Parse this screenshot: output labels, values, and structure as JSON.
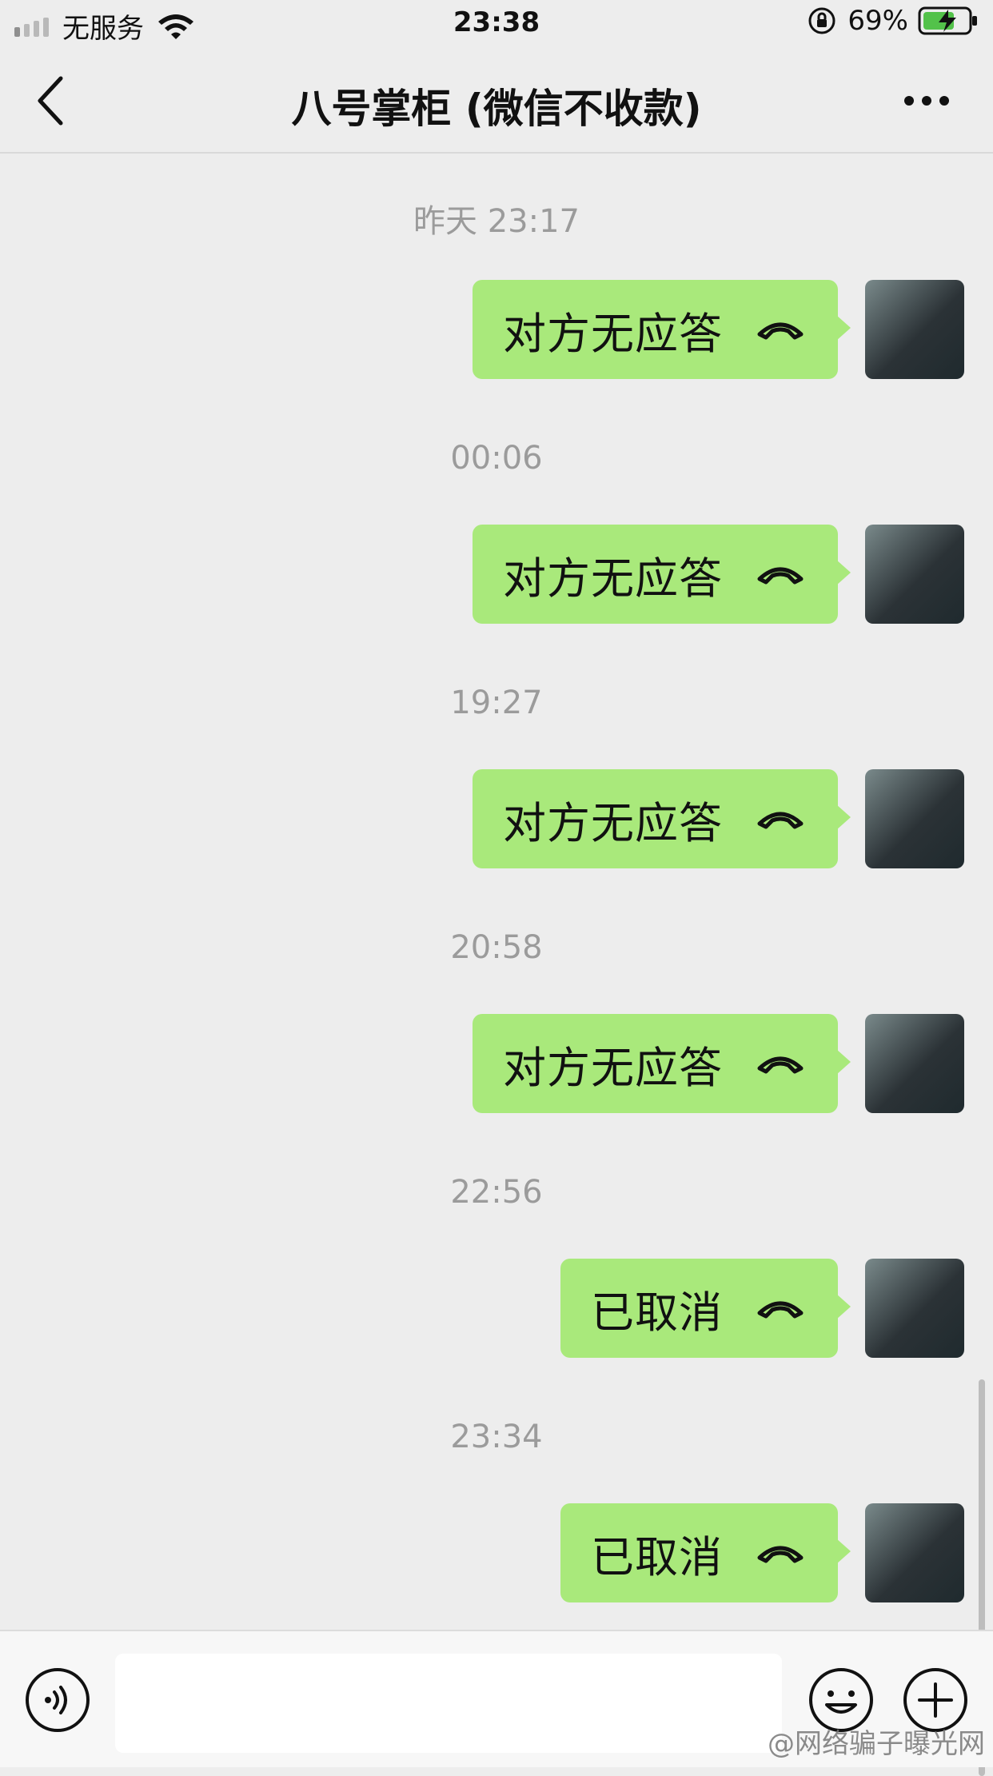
{
  "status_bar": {
    "carrier": "无服务",
    "time": "23:38",
    "battery_percent": "69%",
    "icons": [
      "signal-icon",
      "wifi-icon",
      "rotation-lock-icon",
      "battery-charging-icon"
    ]
  },
  "nav": {
    "title": "八号掌柜 (微信不收款)",
    "icons": [
      "back-chevron-icon",
      "more-icon"
    ]
  },
  "chat": {
    "timestamps": [
      "昨天 23:17",
      "00:06",
      "19:27",
      "20:58",
      "22:56",
      "23:34"
    ],
    "messages": [
      {
        "text": "对方无应答",
        "icon": "phone-hangup-icon"
      },
      {
        "text": "对方无应答",
        "icon": "phone-hangup-icon"
      },
      {
        "text": "对方无应答",
        "icon": "phone-hangup-icon"
      },
      {
        "text": "对方无应答",
        "icon": "phone-hangup-icon"
      },
      {
        "text": "已取消",
        "icon": "phone-hangup-icon"
      },
      {
        "text": "已取消",
        "icon": "phone-hangup-icon"
      }
    ]
  },
  "input_bar": {
    "icons": [
      "voice-icon",
      "emoji-icon",
      "plus-icon"
    ]
  },
  "watermark": "@网络骗子曝光网",
  "colors": {
    "background": "#ededed",
    "bubble": "#a9e97b",
    "muted_text": "#9b9b9b"
  }
}
